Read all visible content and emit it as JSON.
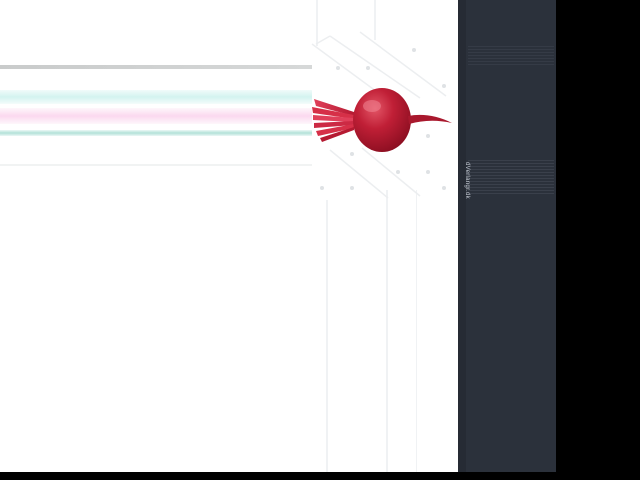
{
  "window": {
    "background": "#000000"
  },
  "main": {
    "background": "#ffffff",
    "image": {
      "subject": "beetroot",
      "icon": "beet-icon",
      "colors": {
        "root": "#b8192f",
        "root_highlight": "#e35667",
        "stem": "#d63048"
      }
    },
    "stripe_colors": [
      "#d6d8d8",
      "#c8f0ec",
      "#fad2ec",
      "#aadbd4"
    ]
  },
  "sidebar": {
    "background": "#2b313b",
    "vertical_label": "dVerlangr.dk"
  }
}
